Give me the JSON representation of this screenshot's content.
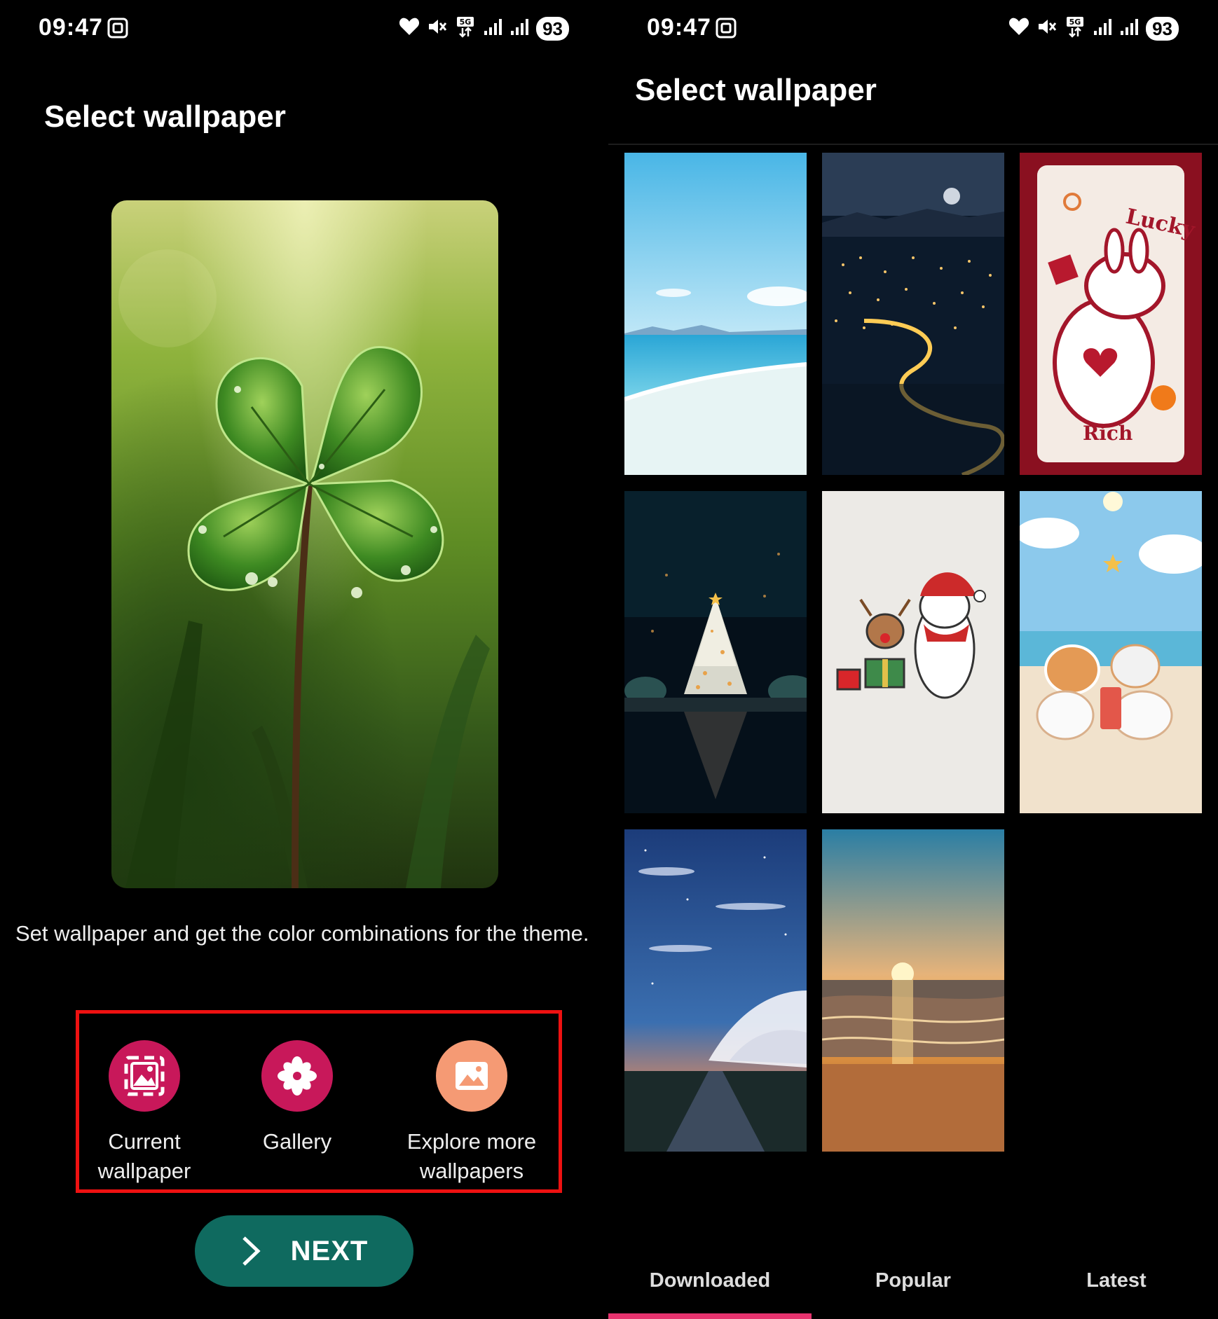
{
  "left_screen": {
    "status": {
      "time": "09:47",
      "battery": "93"
    },
    "title": "Select wallpaper",
    "description": "Set wallpaper and get the color combinations for the theme.",
    "options": [
      {
        "label": "Current wallpaper",
        "icon": "current-wallpaper-icon",
        "color": "#c8185a"
      },
      {
        "label": "Gallery",
        "icon": "gallery-flower-icon",
        "color": "#c8185a"
      },
      {
        "label": "Explore more wallpapers",
        "icon": "explore-image-icon",
        "color": "#f59a74"
      }
    ],
    "highlight_color": "#ee1111",
    "next_button": {
      "label": "NEXT",
      "color": "#0f6a5f"
    }
  },
  "right_screen": {
    "status": {
      "time": "09:47",
      "battery": "93"
    },
    "title": "Select wallpaper",
    "wallpapers": [
      "ocean-beach",
      "night-city-lights",
      "lucky-rich-bunny",
      "christmas-tree-lake",
      "reindeer-penguin",
      "beach-dogs",
      "starry-road",
      "sunset-sea"
    ],
    "tabs": [
      "Downloaded",
      "Popular",
      "Latest"
    ],
    "active_tab": "Downloaded",
    "accent_color": "#e6336e"
  }
}
